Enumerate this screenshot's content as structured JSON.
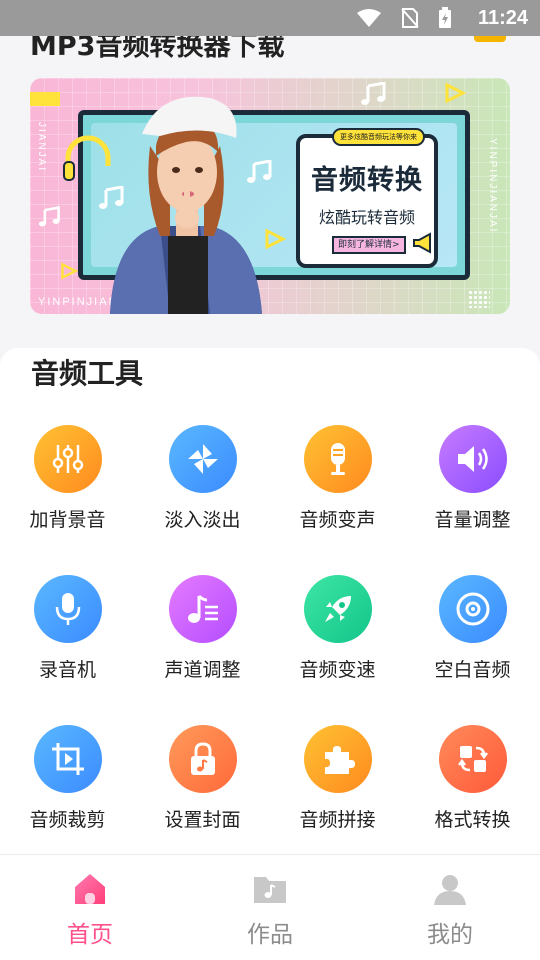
{
  "status_bar": {
    "time": "11:24"
  },
  "header": {
    "title": "MP3音频转换器下载"
  },
  "banner": {
    "tag": "更多炫酷音频玩法等你来",
    "title": "音频转换",
    "subtitle": "炫酷玩转音频",
    "button": "即刻了解详情>",
    "side_left": "JIANJAI",
    "side_right": "YINPINJIANJAI",
    "bottom_left": "YINPINJIAN"
  },
  "tools": {
    "section_title": "音频工具",
    "items": [
      {
        "label": "加背景音",
        "icon": "sliders-icon",
        "color": [
          "#ffc233",
          "#ff8a1f"
        ]
      },
      {
        "label": "淡入淡出",
        "icon": "pinwheel-icon",
        "color": [
          "#5ab8ff",
          "#3b8bff"
        ]
      },
      {
        "label": "音频变声",
        "icon": "microphone-icon",
        "color": [
          "#ffc233",
          "#ff8a1f"
        ]
      },
      {
        "label": "音量调整",
        "icon": "speaker-icon",
        "color": [
          "#c77bff",
          "#8a4dff"
        ]
      },
      {
        "label": "录音机",
        "icon": "mic-icon",
        "color": [
          "#5ab8ff",
          "#3b8bff"
        ]
      },
      {
        "label": "声道调整",
        "icon": "music-list-icon",
        "color": [
          "#e57bff",
          "#b44dff"
        ]
      },
      {
        "label": "音频变速",
        "icon": "rocket-icon",
        "color": [
          "#3ee6a4",
          "#12c58a"
        ]
      },
      {
        "label": "空白音频",
        "icon": "disc-icon",
        "color": [
          "#5ab8ff",
          "#3b8bff"
        ]
      },
      {
        "label": "音频裁剪",
        "icon": "crop-icon",
        "color": [
          "#5ab8ff",
          "#3b8bff"
        ]
      },
      {
        "label": "设置封面",
        "icon": "lock-music-icon",
        "color": [
          "#ff9a5a",
          "#ff6a3a"
        ]
      },
      {
        "label": "音频拼接",
        "icon": "puzzle-icon",
        "color": [
          "#ffc233",
          "#ff8a1f"
        ]
      },
      {
        "label": "格式转换",
        "icon": "convert-icon",
        "color": [
          "#ff8a5a",
          "#ff5a3a"
        ]
      }
    ]
  },
  "nav": {
    "home": {
      "label": "首页",
      "color": "#ff4f8b"
    },
    "works": {
      "label": "作品",
      "color": "#8c8c8c"
    },
    "mine": {
      "label": "我的",
      "color": "#8c8c8c"
    }
  }
}
